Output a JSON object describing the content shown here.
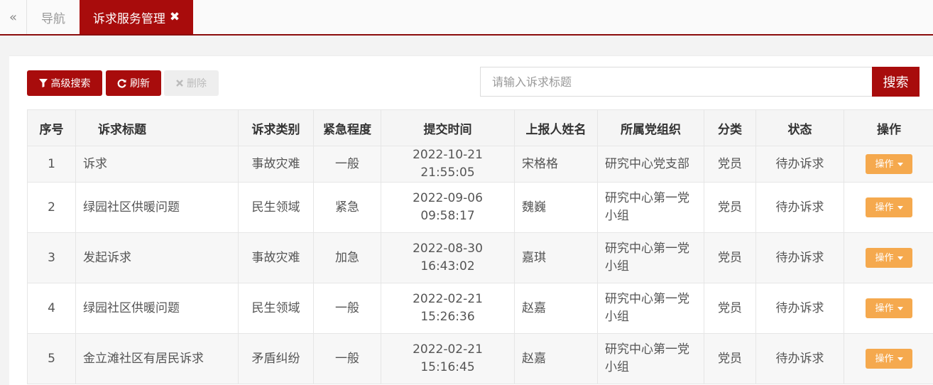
{
  "tabbar": {
    "back_icon": "«",
    "nav_label": "导航",
    "active_label": "诉求服务管理",
    "close_icon": "✖"
  },
  "toolbar": {
    "advanced_label": "高级搜索",
    "refresh_label": "刷新",
    "delete_label": "删除"
  },
  "search": {
    "placeholder": "请输入诉求标题",
    "button_label": "搜索"
  },
  "table": {
    "headers": [
      "序号",
      "诉求标题",
      "诉求类别",
      "紧急程度",
      "提交时间",
      "上报人姓名",
      "所属党组织",
      "分类",
      "状态",
      "操作"
    ],
    "op_label": "操作",
    "rows": [
      {
        "idx": "1",
        "title": "诉求",
        "category": "事故灾难",
        "urgency": "一般",
        "time": "2022-10-21 21:55:05",
        "reporter": "宋格格",
        "org": "研究中心党支部",
        "type": "党员",
        "status": "待办诉求"
      },
      {
        "idx": "2",
        "title": "绿园社区供暖问题",
        "category": "民生领域",
        "urgency": "紧急",
        "time": "2022-09-06 09:58:17",
        "reporter": "魏巍",
        "org": "研究中心第一党小组",
        "type": "党员",
        "status": "待办诉求"
      },
      {
        "idx": "3",
        "title": "发起诉求",
        "category": "事故灾难",
        "urgency": "加急",
        "time": "2022-08-30 16:43:02",
        "reporter": "嘉琪",
        "org": "研究中心第一党小组",
        "type": "党员",
        "status": "待办诉求"
      },
      {
        "idx": "4",
        "title": "绿园社区供暖问题",
        "category": "民生领域",
        "urgency": "一般",
        "time": "2022-02-21 15:26:36",
        "reporter": "赵嘉",
        "org": "研究中心第一党小组",
        "type": "党员",
        "status": "待办诉求"
      },
      {
        "idx": "5",
        "title": "金立滩社区有居民诉求",
        "category": "矛盾纠纷",
        "urgency": "一般",
        "time": "2022-02-21 15:16:45",
        "reporter": "赵嘉",
        "org": "研究中心第一党小组",
        "type": "党员",
        "status": "待办诉求"
      }
    ]
  },
  "colors": {
    "brand": "#a80c0c",
    "op_button": "#f5a94e"
  }
}
